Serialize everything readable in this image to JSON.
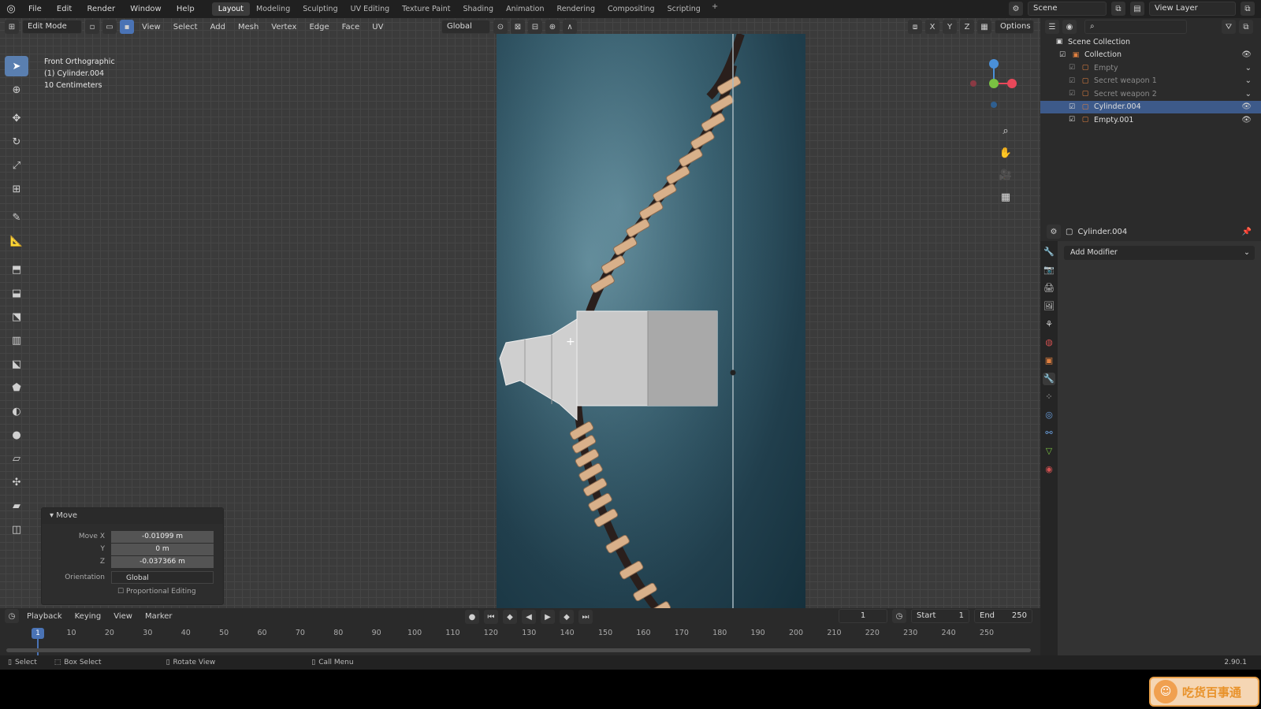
{
  "topbar": {
    "menus": [
      "File",
      "Edit",
      "Render",
      "Window",
      "Help"
    ],
    "workspaces": [
      "Layout",
      "Modeling",
      "Sculpting",
      "UV Editing",
      "Texture Paint",
      "Shading",
      "Animation",
      "Rendering",
      "Compositing",
      "Scripting"
    ],
    "scene": "Scene",
    "view_layer": "View Layer"
  },
  "viewport": {
    "mode": "Edit Mode",
    "menus": [
      "View",
      "Select",
      "Add",
      "Mesh",
      "Vertex",
      "Edge",
      "Face",
      "UV"
    ],
    "transform_orientation": "Global",
    "options": "Options",
    "info": [
      "Front Orthographic",
      "(1) Cylinder.004",
      "10 Centimeters"
    ],
    "gizmo_axes": {
      "x": "X",
      "y": "Y",
      "z": "Z"
    }
  },
  "operator": {
    "title": "Move",
    "move_x_label": "Move X",
    "move_x": "-0.01099 m",
    "y_label": "Y",
    "y": "0 m",
    "z_label": "Z",
    "z": "-0.037366 m",
    "orientation_label": "Orientation",
    "orientation": "Global",
    "proportional": "Proportional Editing"
  },
  "timeline": {
    "menus": [
      "Playback",
      "Keying",
      "View",
      "Marker"
    ],
    "current_frame": "1",
    "start_label": "Start",
    "start": "1",
    "end_label": "End",
    "end": "250",
    "ticks": [
      "1",
      "10",
      "20",
      "30",
      "40",
      "50",
      "60",
      "70",
      "80",
      "90",
      "100",
      "110",
      "120",
      "130",
      "140",
      "150",
      "160",
      "170",
      "180",
      "190",
      "200",
      "210",
      "220",
      "230",
      "240",
      "250"
    ]
  },
  "status": {
    "select": "Select",
    "box_select": "Box Select",
    "rotate_view": "Rotate View",
    "call_menu": "Call Menu",
    "version": "2.90.1"
  },
  "outliner": {
    "root": "Scene Collection",
    "items": [
      {
        "name": "Collection",
        "level": 1,
        "dim": false,
        "selected": false
      },
      {
        "name": "Empty",
        "level": 2,
        "dim": true,
        "selected": false
      },
      {
        "name": "Secret weapon 1",
        "level": 2,
        "dim": true,
        "selected": false
      },
      {
        "name": "Secret weapon 2",
        "level": 2,
        "dim": true,
        "selected": false
      },
      {
        "name": "Cylinder.004",
        "level": 2,
        "dim": false,
        "selected": true
      },
      {
        "name": "Empty.001",
        "level": 2,
        "dim": false,
        "selected": false
      }
    ]
  },
  "properties": {
    "object": "Cylinder.004",
    "add_modifier": "Add Modifier"
  },
  "watermark": "吃货百事通",
  "colors": {
    "accent": "#4a73b5",
    "selected_row": "#3d5a8a",
    "x_axis": "#e8485a",
    "y_axis": "#7ac142",
    "z_axis": "#4a90d9"
  }
}
